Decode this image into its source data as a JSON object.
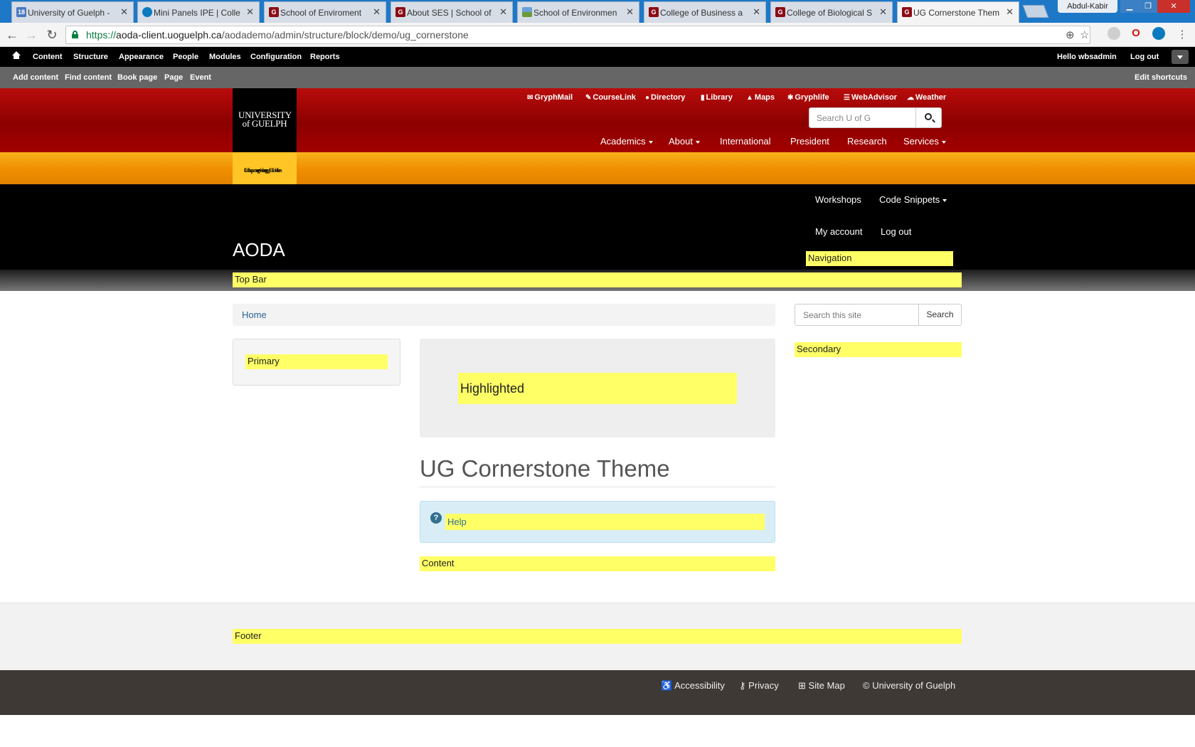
{
  "browser": {
    "tabs": [
      {
        "title": "University of Guelph -",
        "favicon": "calendar-favicon"
      },
      {
        "title": "Mini Panels IPE | Colle",
        "favicon": "drupal-favicon"
      },
      {
        "title": "School of Enviroment",
        "favicon": "guelph-favicon"
      },
      {
        "title": "About SES | School of",
        "favicon": "guelph-favicon"
      },
      {
        "title": "School of Environmen",
        "favicon": "landscape-favicon"
      },
      {
        "title": "College of Business a",
        "favicon": "guelph-favicon"
      },
      {
        "title": "College of Biological S",
        "favicon": "guelph-favicon"
      },
      {
        "title": "UG Cornerstone Them",
        "favicon": "guelph-favicon",
        "active": true
      }
    ],
    "user": "Abdul-Kabir",
    "url_scheme": "https://",
    "url_host": "aoda-client.uoguelph.ca",
    "url_path": "/aodademo/admin/structure/block/demo/ug_cornerstone"
  },
  "admin_toolbar": {
    "menu": [
      "Content",
      "Structure",
      "Appearance",
      "People",
      "Modules",
      "Configuration",
      "Reports"
    ],
    "hello_prefix": "Hello",
    "username": "wbsadmin",
    "logout": "Log out",
    "shortcuts": [
      "Add content",
      "Find content",
      "Book page",
      "Page",
      "Event"
    ],
    "edit_shortcuts": "Edit shortcuts"
  },
  "ug_header": {
    "logo_line1": "UNIVERSITY",
    "logo_line2": "of GUELPH",
    "tagline_line1": "Changing Lives",
    "tagline_line2": "Improving Life",
    "utility_links": [
      "GryphMail",
      "CourseLink",
      "Directory",
      "Library",
      "Maps",
      "Gryphlife",
      "WebAdvisor",
      "Weather"
    ],
    "search_placeholder": "Search U of G",
    "main_nav": [
      "Academics",
      "About",
      "International",
      "President",
      "Research",
      "Services"
    ]
  },
  "site": {
    "title": "AODA",
    "nav": [
      "Workshops",
      "Code Snippets",
      "My account",
      "Log out"
    ],
    "breadcrumb": "Home",
    "search_placeholder": "Search this site",
    "search_button": "Search",
    "page_title": "UG Cornerstone Theme"
  },
  "regions": {
    "navigation": "Navigation",
    "top_bar": "Top Bar",
    "primary": "Primary",
    "highlighted": "Highlighted",
    "secondary": "Secondary",
    "help": "Help",
    "content": "Content",
    "footer": "Footer"
  },
  "footer": {
    "links": [
      "Accessibility",
      "Privacy",
      "Site Map",
      "© University of Guelph"
    ]
  },
  "colors": {
    "ug_red": "#b90c0c",
    "ug_gold": "#f7b21b",
    "region_highlight": "#ffff66",
    "footer_dark": "#3e3935"
  }
}
